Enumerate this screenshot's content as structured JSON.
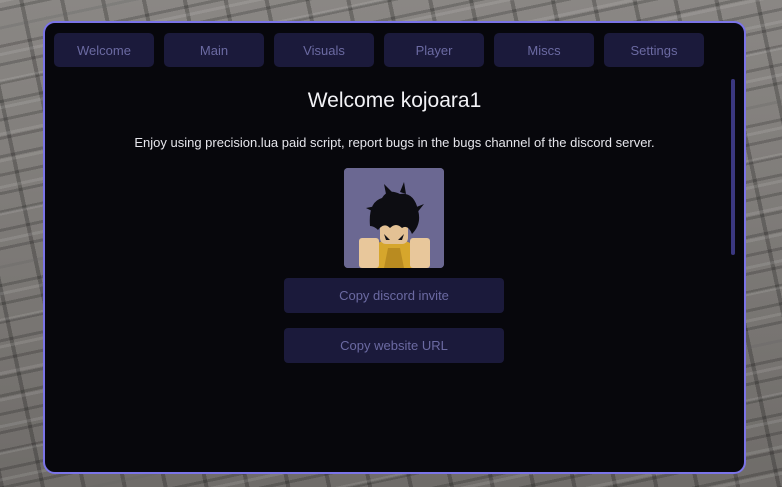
{
  "tabs": [
    {
      "label": "Welcome"
    },
    {
      "label": "Main"
    },
    {
      "label": "Visuals"
    },
    {
      "label": "Player"
    },
    {
      "label": "Miscs"
    },
    {
      "label": "Settings"
    }
  ],
  "welcome": {
    "title": "Welcome kojoara1",
    "message": "Enjoy using precision.lua paid script, report bugs in the bugs channel of the discord server.",
    "buttons": {
      "discord": "Copy discord invite",
      "website": "Copy website URL"
    }
  },
  "colors": {
    "accent_border": "#7b74e8",
    "panel_bg": "#07070c",
    "button_bg": "#1b1a3b",
    "button_text": "#6b6aa2"
  }
}
